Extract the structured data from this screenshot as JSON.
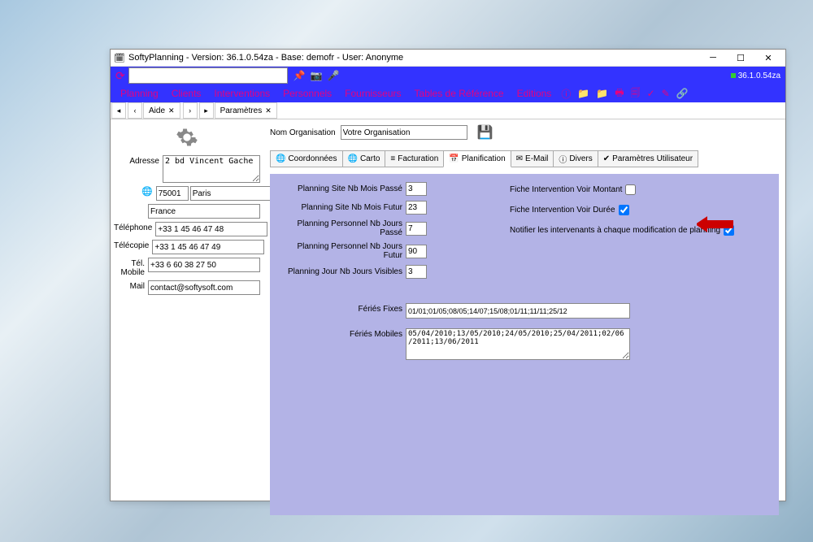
{
  "window": {
    "title": "SoftyPlanning - Version: 36.1.0.54za - Base: demofr - User: Anonyme",
    "version": "36.1.0.54za"
  },
  "menu": {
    "items": [
      "Planning",
      "Clients",
      "Interventions",
      "Personnels",
      "Fournisseurs",
      "Tables de Référence",
      "Editions"
    ]
  },
  "doctabs": [
    {
      "label": "Aide"
    },
    {
      "label": "Paramètres"
    }
  ],
  "org": {
    "label": "Nom Organisation",
    "value": "Votre Organisation"
  },
  "address": {
    "label": "Adresse",
    "value": "2 bd Vincent Gache",
    "postal": "75001",
    "city": "Paris",
    "country": "France",
    "phone_label": "Téléphone",
    "phone": "+33 1 45 46 47 48",
    "fax_label": "Télécopie",
    "fax": "+33 1 45 46 47 49",
    "mobile_label": "Tél. Mobile",
    "mobile": "+33 6 60 38 27 50",
    "mail_label": "Mail",
    "mail": "contact@softysoft.com"
  },
  "subtabs": [
    {
      "icon": "🌐",
      "label": "Coordonnées"
    },
    {
      "icon": "🌐",
      "label": "Carto"
    },
    {
      "icon": "≡",
      "label": "Facturation"
    },
    {
      "icon": "📅",
      "label": "Planification",
      "active": true
    },
    {
      "icon": "✉",
      "label": "E-Mail"
    },
    {
      "icon": "ⓘ",
      "label": "Divers"
    },
    {
      "icon": "✔",
      "label": "Paramètres Utilisateur"
    }
  ],
  "plan": {
    "site_past_label": "Planning Site Nb Mois Passé",
    "site_past": "3",
    "site_future_label": "Planning Site Nb Mois Futur",
    "site_future": "23",
    "pers_past_label": "Planning Personnel Nb Jours Passé",
    "pers_past": "7",
    "pers_future_label": "Planning Personnel Nb Jours Futur",
    "pers_future": "90",
    "day_visible_label": "Planning Jour Nb Jours Visibles",
    "day_visible": "3",
    "fi_montant": "Fiche Intervention Voir Montant",
    "fi_duree": "Fiche Intervention Voir Durée",
    "notify": "Notifier les intervenants à chaque modification de planning",
    "feries_fixes_label": "Fériés Fixes",
    "feries_fixes": "01/01;01/05;08/05;14/07;15/08;01/11;11/11;25/12",
    "feries_mobiles_label": "Fériés Mobiles",
    "feries_mobiles": "05/04/2010;13/05/2010;24/05/2010;25/04/2011;02/06/2011;13/06/2011"
  }
}
